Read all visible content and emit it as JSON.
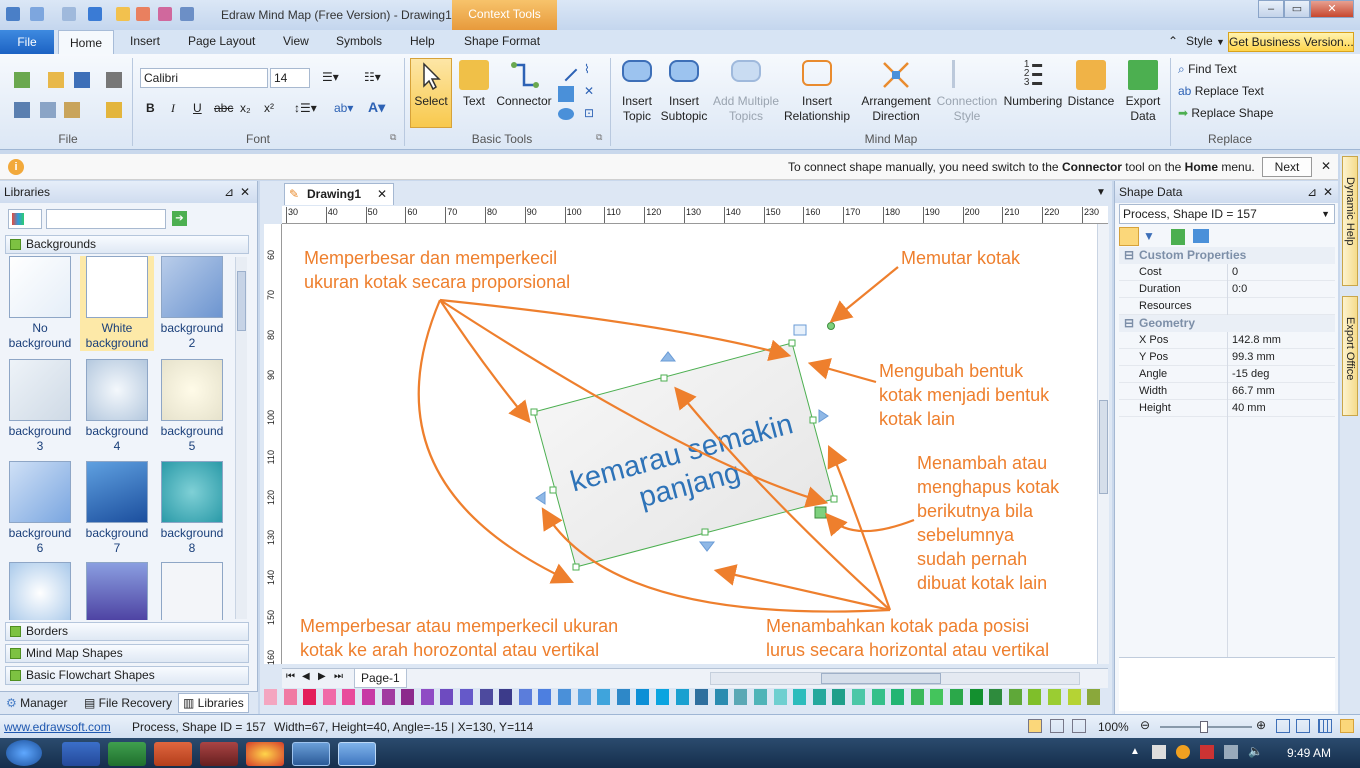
{
  "window": {
    "title": "Edraw Mind Map (Free Version) - Drawing1",
    "context_tab": "Context Tools",
    "min_label": "‒",
    "max_label": "▭",
    "close_label": "✕"
  },
  "ribbon_tabs": {
    "file": "File",
    "home": "Home",
    "insert": "Insert",
    "page_layout": "Page Layout",
    "view": "View",
    "symbols": "Symbols",
    "help": "Help",
    "shape_format": "Shape Format",
    "style": "Style",
    "business": "Get Business Version..."
  },
  "ribbon": {
    "font_name": "Calibri",
    "font_size": "14",
    "groups": {
      "file": "File",
      "font": "Font",
      "basic_tools": "Basic Tools",
      "mind_map": "Mind Map",
      "replace": "Replace"
    },
    "buttons": {
      "select": "Select",
      "text": "Text",
      "connector": "Connector",
      "insert_topic_1": "Insert",
      "insert_topic_2": "Topic",
      "insert_subtopic_1": "Insert",
      "insert_subtopic_2": "Subtopic",
      "add_multiple_1": "Add Multiple",
      "add_multiple_2": "Topics",
      "insert_rel_1": "Insert",
      "insert_rel_2": "Relationship",
      "arrangement_1": "Arrangement",
      "arrangement_2": "Direction",
      "connection_1": "Connection",
      "connection_2": "Style",
      "numbering": "Numbering",
      "distance": "Distance",
      "export_1": "Export",
      "export_2": "Data",
      "find_text": "Find Text",
      "replace_text": "Replace Text",
      "replace_shape": "Replace Shape"
    },
    "font_buttons": {
      "bold": "B",
      "italic": "I",
      "underline": "U",
      "strike": "abc",
      "subscript": "x₂",
      "superscript": "x²"
    }
  },
  "infobar": {
    "text_pre": "To connect shape manually, you need switch to the ",
    "connector": "Connector",
    "text_mid": " tool on the ",
    "home": "Home",
    "text_post": " menu.",
    "next": "Next",
    "close": "✕"
  },
  "libraries": {
    "title": "Libraries",
    "pin": "⊿",
    "close": "✕",
    "sections": {
      "backgrounds": "Backgrounds",
      "borders": "Borders",
      "mind_map_shapes": "Mind Map Shapes",
      "basic_flowchart": "Basic Flowchart Shapes"
    },
    "thumbs": [
      {
        "l1": "No",
        "l2": "background"
      },
      {
        "l1": "White",
        "l2": "background"
      },
      {
        "l1": "background",
        "l2": "2"
      },
      {
        "l1": "background",
        "l2": "3"
      },
      {
        "l1": "background",
        "l2": "4"
      },
      {
        "l1": "background",
        "l2": "5"
      },
      {
        "l1": "background",
        "l2": "6"
      },
      {
        "l1": "background",
        "l2": "7"
      },
      {
        "l1": "background",
        "l2": "8"
      }
    ],
    "tabs": {
      "manager": "Manager",
      "file_recovery": "File Recovery",
      "libraries": "Libraries"
    }
  },
  "document": {
    "tab": "Drawing1",
    "tab_close": "✕",
    "page": "Page-1",
    "ruler_h": [
      "30",
      "40",
      "50",
      "60",
      "70",
      "80",
      "90",
      "100",
      "110",
      "120",
      "130",
      "140",
      "150",
      "160",
      "170",
      "180",
      "190",
      "200",
      "210",
      "220",
      "230"
    ],
    "ruler_v": [
      "60",
      "70",
      "80",
      "90",
      "100",
      "110",
      "120",
      "130",
      "140",
      "150",
      "160"
    ],
    "shape_text_1": "kemarau semakin",
    "shape_text_2": "panjang",
    "annotations": {
      "a1_line1": "Memperbesar dan memperkecil",
      "a1_line2": "ukuran kotak secara proporsional",
      "a2": "Memutar kotak",
      "a3_line1": "Mengubah bentuk",
      "a3_line2": "kotak menjadi bentuk",
      "a3_line3": "kotak lain",
      "a4_line1": "Menambah atau",
      "a4_line2": "menghapus kotak",
      "a4_line3": "berikutnya bila",
      "a4_line4": "sebelumnya",
      "a4_line5": "sudah pernah",
      "a4_line6": "dibuat kotak lain",
      "a5_line1": "Memperbesar atau memperkecil ukuran",
      "a5_line2": "kotak ke arah horozontal atau vertikal",
      "a6_line1": "Menambahkan kotak pada posisi",
      "a6_line2": "lurus secara horizontal atau vertikal"
    },
    "palette": [
      "#f4a6c0",
      "#f07aa3",
      "#e31e5b",
      "#f06aa8",
      "#e84b9c",
      "#c73aa5",
      "#a13ba0",
      "#8c2a8c",
      "#8f4cc4",
      "#6e4bc0",
      "#6559c9",
      "#4d4a9e",
      "#3c3b8a",
      "#5b7ddb",
      "#4d7fe0",
      "#4a90d9",
      "#5aa2e0",
      "#3fa4dc",
      "#2e88c8",
      "#0c8fd6",
      "#0aa4e0",
      "#1aa0d0",
      "#2e6f9e",
      "#2b8cb0",
      "#5aa8b5",
      "#4fb4b8",
      "#6fcfd0",
      "#2cbcbc",
      "#25a89d",
      "#1f9f8a",
      "#4cc7a7",
      "#35c08a",
      "#22b573",
      "#3ab85a",
      "#44c45c",
      "#2ba84a",
      "#13902f",
      "#2e8b3d",
      "#5fa839",
      "#7fbf2a",
      "#9acd32",
      "#b5d334",
      "#8aa83b"
    ]
  },
  "shape_data": {
    "title": "Shape Data",
    "pin": "⊿",
    "close": "✕",
    "selected": "Process, Shape ID = 157",
    "groups": {
      "custom": "Custom Properties",
      "geometry": "Geometry"
    },
    "custom_rows": [
      {
        "k": "Cost",
        "v": "0"
      },
      {
        "k": "Duration",
        "v": "0:0"
      },
      {
        "k": "Resources",
        "v": ""
      }
    ],
    "geometry_rows": [
      {
        "k": "X Pos",
        "v": "142.8 mm"
      },
      {
        "k": "Y Pos",
        "v": "99.3 mm"
      },
      {
        "k": "Angle",
        "v": "-15 deg"
      },
      {
        "k": "Width",
        "v": "66.7 mm"
      },
      {
        "k": "Height",
        "v": "40 mm"
      }
    ]
  },
  "side_tabs": {
    "dynamic_help": "Dynamic Help",
    "export_office": "Export Office"
  },
  "status": {
    "link": "www.edrawsoft.com",
    "shape": "Process, Shape ID = 157",
    "info": "Width=67, Height=40, Angle=-15 | X=130, Y=114",
    "zoom": "100%"
  },
  "taskbar": {
    "time": "9:49 AM"
  }
}
